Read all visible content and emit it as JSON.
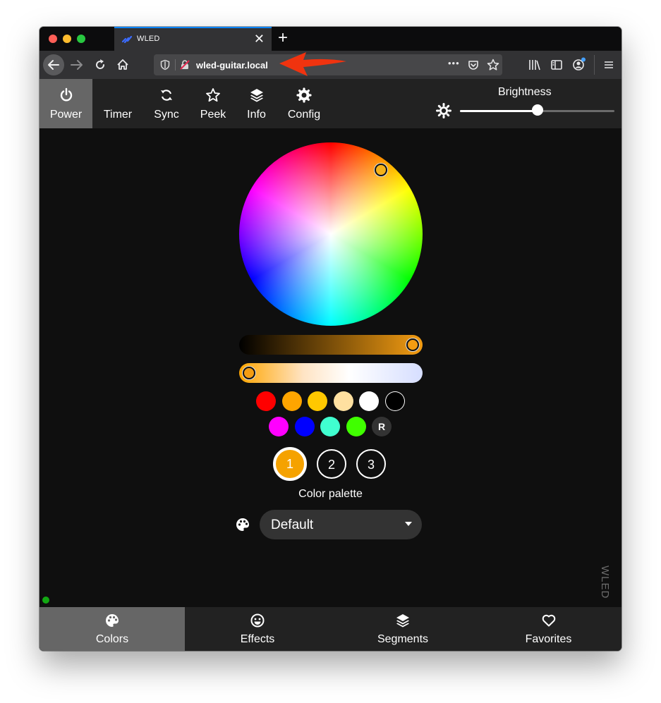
{
  "browser": {
    "tab_title": "WLED",
    "tab_close": "✕",
    "new_tab": "+",
    "url": "wled-guitar.local",
    "page_actions": "•••"
  },
  "app": {
    "nav": [
      {
        "label": "Power",
        "icon": "power-icon",
        "active": true
      },
      {
        "label": "Timer",
        "icon": "moon-icon",
        "active": false
      },
      {
        "label": "Sync",
        "icon": "sync-icon",
        "active": false
      },
      {
        "label": "Peek",
        "icon": "star-icon",
        "active": false
      },
      {
        "label": "Info",
        "icon": "layers-icon",
        "active": false
      },
      {
        "label": "Config",
        "icon": "gear-icon",
        "active": false
      }
    ],
    "brightness": {
      "label": "Brightness",
      "value": 0.5
    }
  },
  "colors": {
    "quick_swatches_row1": [
      "#ff0000",
      "#ffa500",
      "#ffc800",
      "#ffe0a0",
      "#ffffff",
      "#000000"
    ],
    "quick_swatches_row2": [
      "#ff00ff",
      "#0000ff",
      "#40ffd0",
      "#40ff00"
    ],
    "random_label": "R",
    "slots": [
      "1",
      "2",
      "3"
    ],
    "selected_slot": "1",
    "selected_color": "#f5b21a",
    "palette_label": "Color palette",
    "palette_value": "Default",
    "watermark": "WLED"
  },
  "bottom_nav": [
    {
      "label": "Colors",
      "icon": "palette-icon",
      "active": true
    },
    {
      "label": "Effects",
      "icon": "smiley-icon",
      "active": false
    },
    {
      "label": "Segments",
      "icon": "layers-icon",
      "active": false
    },
    {
      "label": "Favorites",
      "icon": "heart-icon",
      "active": false
    }
  ]
}
